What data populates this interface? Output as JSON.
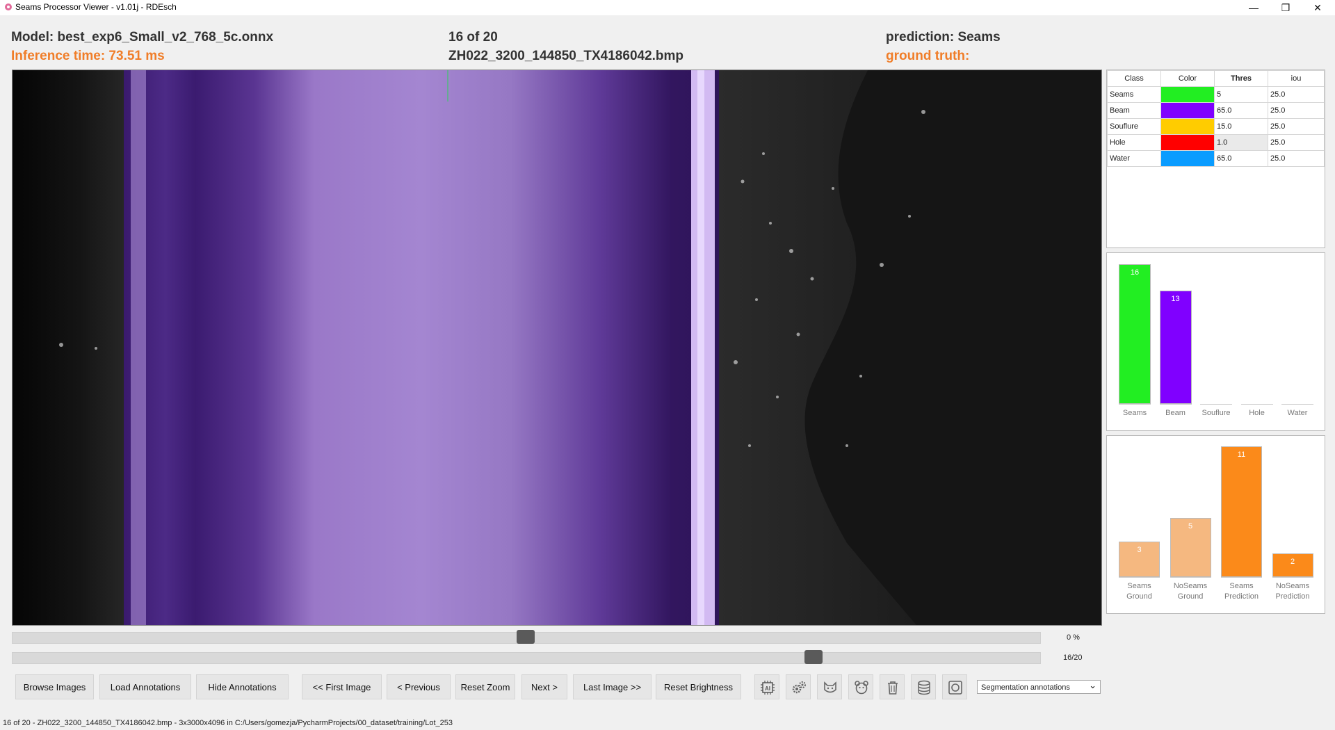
{
  "window": {
    "title": "Seams Processor Viewer - v1.01j - RDEsch",
    "minimize": "—",
    "restore": "❐",
    "close": "✕"
  },
  "header": {
    "model": "Model: best_exp6_Small_v2_768_5c.onnx",
    "inference": "Inference time: 73.51 ms",
    "counter": "16 of 20",
    "filename": "ZH022_3200_144850_TX4186042.bmp",
    "prediction": "prediction: Seams",
    "ground_truth": "ground truth:"
  },
  "class_table": {
    "headers": [
      "Class",
      "Color",
      "Thres",
      "iou"
    ],
    "rows": [
      {
        "name": "Seams",
        "color": "#22ee22",
        "thres": "5",
        "iou": "25.0"
      },
      {
        "name": "Beam",
        "color": "#8000ff",
        "thres": "65.0",
        "iou": "25.0"
      },
      {
        "name": "Souflure",
        "color": "#ffcc00",
        "thres": "15.0",
        "iou": "25.0"
      },
      {
        "name": "Hole",
        "color": "#ff0000",
        "thres": "1.0",
        "iou": "25.0"
      },
      {
        "name": "Water",
        "color": "#0a9cff",
        "thres": "65.0",
        "iou": "25.0"
      }
    ]
  },
  "class_counts": {
    "categories": [
      "Seams",
      "Beam",
      "Souflure",
      "Hole",
      "Water"
    ],
    "values": [
      16,
      13,
      0,
      0,
      0
    ],
    "colors": [
      "#22ee22",
      "#8000ff",
      "#cccccc",
      "#cccccc",
      "#cccccc"
    ],
    "max": 16
  },
  "gt_counts": {
    "categories": [
      [
        "Seams",
        "Ground"
      ],
      [
        "NoSeams",
        "Ground"
      ],
      [
        "Seams",
        "Prediction"
      ],
      [
        "NoSeams",
        "Prediction"
      ]
    ],
    "values": [
      3,
      5,
      11,
      2
    ],
    "colors": [
      "#f5b880",
      "#f5b880",
      "#fb8a1a",
      "#fb8a1a"
    ],
    "max": 11
  },
  "sliders": {
    "brightness_label": "0 %",
    "brightness_fraction": 0.5,
    "image_label": "16/20",
    "image_fraction": 0.785
  },
  "buttons": {
    "browse": "Browse Images",
    "load_ann": "Load Annotations",
    "hide_ann": "Hide Annotations",
    "first": "<< First Image",
    "previous": "< Previous",
    "reset_zoom": "Reset Zoom",
    "next": "Next >",
    "last": "Last Image >>",
    "reset_brightness": "Reset Brightness"
  },
  "dropdown": {
    "selected": "Segmentation annotations",
    "arrow": "⌄"
  },
  "status": "16 of 20 - ZH022_3200_144850_TX4186042.bmp - 3x3000x4096 in C:/Users/gomezja/PycharmProjects/00_dataset/training/Lot_253"
}
